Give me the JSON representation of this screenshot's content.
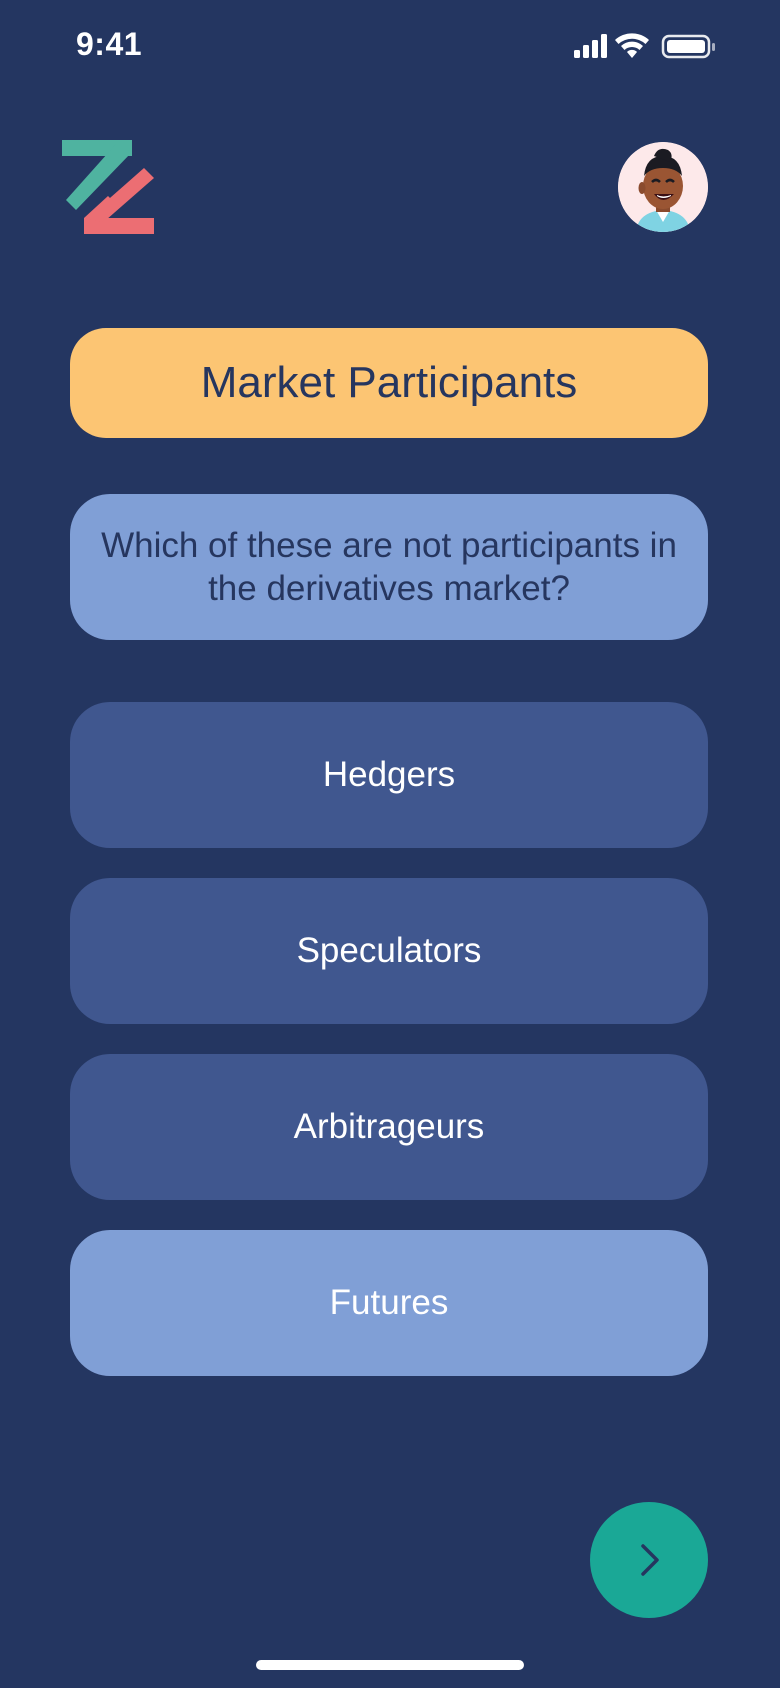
{
  "status_bar": {
    "time": "9:41"
  },
  "icons": {
    "logo": "z-logo",
    "avatar": "user-avatar",
    "next": "chevron-right-icon",
    "signal": "cellular-signal-icon",
    "wifi": "wifi-icon",
    "battery": "battery-icon"
  },
  "quiz": {
    "topic": "Market Participants",
    "question": "Which of these are not participants in the derivatives market?",
    "options": [
      {
        "label": "Hedgers",
        "selected": false
      },
      {
        "label": "Speculators",
        "selected": false
      },
      {
        "label": "Arbitrageurs",
        "selected": false
      },
      {
        "label": "Futures",
        "selected": true
      }
    ]
  },
  "colors": {
    "background": "#243661",
    "topic_pill": "#fcc573",
    "question_card": "#809fd6",
    "option_default": "#40578f",
    "option_selected": "#809fd6",
    "next_button": "#1aa896",
    "logo_green": "#4fb3a0",
    "logo_red": "#ec6e73"
  }
}
